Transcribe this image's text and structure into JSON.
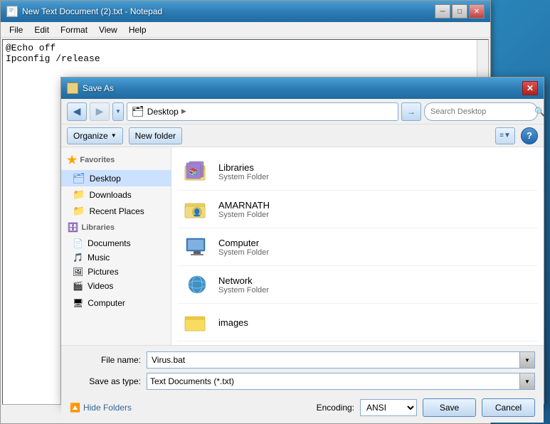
{
  "notepad": {
    "title": "New Text Document (2).txt - Notepad",
    "content_line1": "@Echo off",
    "content_line2": "Ipconfig /release",
    "menu_items": [
      "File",
      "Edit",
      "Format",
      "View",
      "Help"
    ]
  },
  "saveas": {
    "title": "Save As",
    "location": "Desktop",
    "location_chevron": "▶",
    "search_placeholder": "Search Desktop",
    "toolbar": {
      "organize_label": "Organize",
      "new_folder_label": "New folder"
    },
    "sidebar": {
      "favorites_label": "Favorites",
      "desktop_label": "Desktop",
      "downloads_label": "Downloads",
      "recent_places_label": "Recent Places",
      "libraries_label": "Libraries",
      "documents_label": "Documents",
      "music_label": "Music",
      "pictures_label": "Pictures",
      "videos_label": "Videos",
      "computer_label": "Computer"
    },
    "files": [
      {
        "name": "Libraries",
        "type": "System Folder"
      },
      {
        "name": "AMARNATH",
        "type": "System Folder"
      },
      {
        "name": "Computer",
        "type": "System Folder"
      },
      {
        "name": "Network",
        "type": "System Folder"
      },
      {
        "name": "images",
        "type": ""
      }
    ],
    "file_name_label": "File name:",
    "file_name_value": "Virus.bat",
    "save_as_type_label": "Save as type:",
    "save_as_type_value": "Text Documents (*.txt)",
    "encoding_label": "Encoding:",
    "encoding_value": "ANSI",
    "hide_folders_label": "Hide Folders",
    "save_btn_label": "Save",
    "cancel_btn_label": "Cancel"
  },
  "window_controls": {
    "minimize": "─",
    "maximize": "□",
    "close": "✕"
  }
}
